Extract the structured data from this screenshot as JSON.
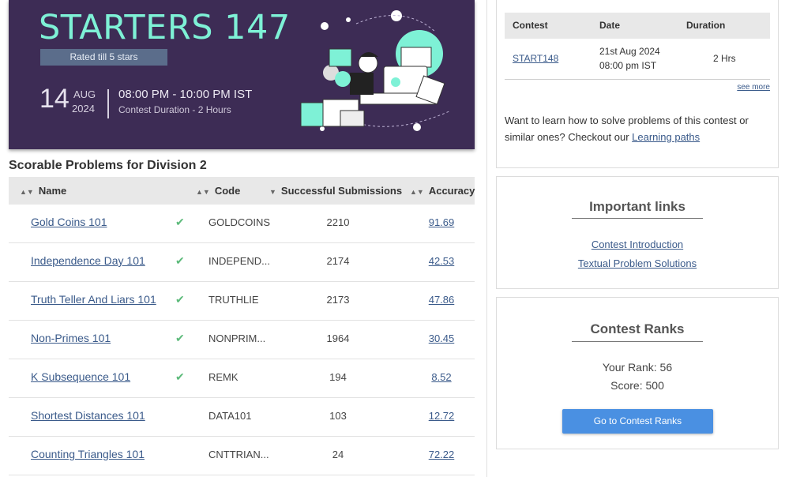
{
  "banner": {
    "title": "STARTERS 147",
    "rated": "Rated till 5 stars",
    "day": "14",
    "month": "AUG",
    "year": "2024",
    "time": "08:00 PM - 10:00 PM IST",
    "duration": "Contest Duration - 2  Hours"
  },
  "section_title": "Scorable Problems for Division 2",
  "table": {
    "headers": {
      "name": "Name",
      "code": "Code",
      "subs": "Successful Submissions",
      "accuracy": "Accuracy"
    },
    "rows": [
      {
        "name": "Gold Coins 101",
        "solved": true,
        "code": "GOLDCOINS",
        "subs": "2210",
        "accuracy": "91.69"
      },
      {
        "name": "Independence Day 101",
        "solved": true,
        "code": "INDEPEND...",
        "subs": "2174",
        "accuracy": "42.53"
      },
      {
        "name": "Truth Teller And Liars 101",
        "solved": true,
        "code": "TRUTHLIE",
        "subs": "2173",
        "accuracy": "47.86"
      },
      {
        "name": "Non-Primes 101",
        "solved": true,
        "code": "NONPRIM...",
        "subs": "1964",
        "accuracy": "30.45"
      },
      {
        "name": "K Subsequence 101",
        "solved": true,
        "code": "REMK",
        "subs": "194",
        "accuracy": "8.52"
      },
      {
        "name": "Shortest Distances 101",
        "solved": false,
        "code": "DATA101",
        "subs": "103",
        "accuracy": "12.72"
      },
      {
        "name": "Counting Triangles 101",
        "solved": false,
        "code": "CNTTRIAN...",
        "subs": "24",
        "accuracy": "72.22"
      }
    ]
  },
  "next_contest": {
    "headers": {
      "contest": "Contest",
      "date": "Date",
      "duration": "Duration"
    },
    "row": {
      "contest": "START148",
      "date_line1": "21st Aug 2024",
      "date_line2": "08:00 pm IST",
      "duration": "2 Hrs"
    },
    "see_more": "see more",
    "learn_prefix": "Want to learn how to solve problems of this contest or similar ones? Checkout our ",
    "learn_link": "Learning paths"
  },
  "important_links": {
    "title": "Important links",
    "links": [
      "Contest Introduction",
      "Textual Problem Solutions"
    ]
  },
  "contest_ranks": {
    "title": "Contest Ranks",
    "your_rank": "Your Rank: 56",
    "score": "Score: 500",
    "button": "Go to Contest Ranks"
  },
  "icons": {
    "check": "check-icon",
    "sort": "sort-icon"
  },
  "colors": {
    "banner_bg": "#3d2c55",
    "banner_title": "#7ef1d6",
    "link": "#3a5a8a",
    "check": "#5cba7a",
    "button": "#4a90e2"
  }
}
